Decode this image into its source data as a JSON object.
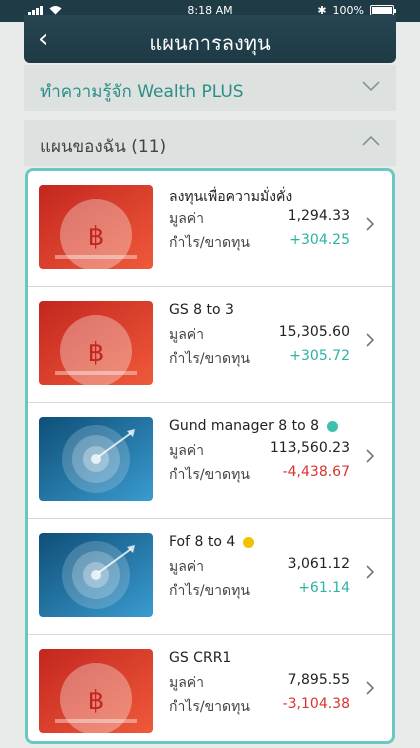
{
  "status_bar": {
    "time": "8:18 AM",
    "battery": "100%",
    "battery_level": 1.0
  },
  "header": {
    "title": "แผนการลงทุน"
  },
  "sections": [
    {
      "label": "ทำความรู้จัก Wealth PLUS",
      "expanded": false
    },
    {
      "label": "แผนของฉัน (11)",
      "expanded": true
    }
  ],
  "labels": {
    "value": "มูลค่า",
    "gain_loss": "กำไร/ขาดทุน"
  },
  "plans": [
    {
      "name": "ลงทุนเพื่อความมั่งคั่ง",
      "value": "1,294.33",
      "gain": "+304.25",
      "gain_status": "positive",
      "image": "piggy-coin-icon",
      "status_dot": null
    },
    {
      "name": "GS 8 to 3",
      "value": "15,305.60",
      "gain": "+305.72",
      "gain_status": "positive",
      "image": "piggy-coin-icon",
      "status_dot": null
    },
    {
      "name": "Gund manager 8 to 8",
      "value": "113,560.23",
      "gain": "-4,438.67",
      "gain_status": "negative",
      "image": "target-icon",
      "status_dot": "#3fbfae"
    },
    {
      "name": "Fof 8 to 4",
      "value": "3,061.12",
      "gain": "+61.14",
      "gain_status": "positive",
      "image": "target-icon",
      "status_dot": "#f2c200"
    },
    {
      "name": "GS CRR1",
      "value": "7,895.55",
      "gain": "-3,104.38",
      "gain_status": "negative",
      "image": "piggy-coin-icon",
      "status_dot": null
    }
  ],
  "colors": {
    "header": "#1d3a45",
    "accent": "#2b8f86",
    "positive": "#2bb3a3",
    "negative": "#d7352f",
    "card_border": "#6cc8bf"
  }
}
